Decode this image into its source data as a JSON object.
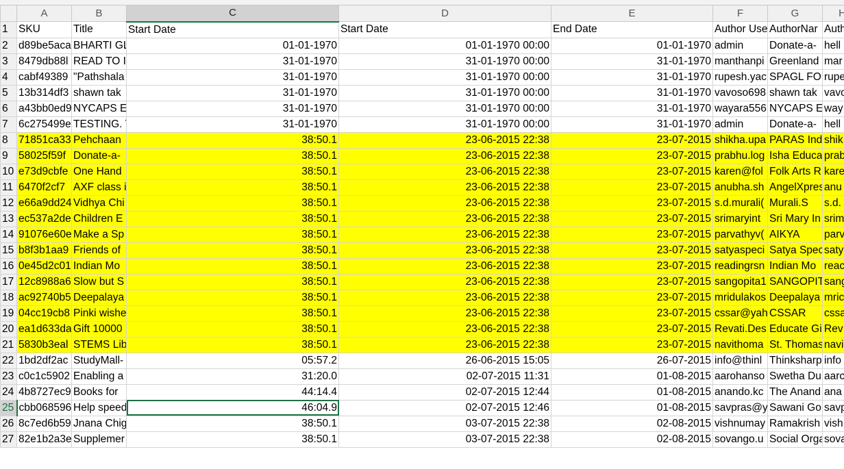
{
  "columns": [
    "A",
    "B",
    "C",
    "D",
    "E",
    "F",
    "G",
    "H"
  ],
  "active_column": "C",
  "active_row": "25",
  "rows": [
    {
      "n": "1",
      "hl": false,
      "cells": [
        "SKU",
        "Title",
        "Start Date",
        "Start Date",
        "End Date",
        "Author Use",
        "AuthorNar",
        "Auth"
      ]
    },
    {
      "n": "2",
      "hl": false,
      "cells": [
        "d89be5aca",
        "BHARTI GL",
        "01-01-1970",
        "01-01-1970 00:00",
        "01-01-1970",
        "admin",
        "Donate-a-",
        "hell"
      ]
    },
    {
      "n": "3",
      "hl": false,
      "cells": [
        "8479db88l",
        "READ  TO I",
        "31-01-1970",
        "31-01-1970 00:00",
        "31-01-1970",
        "manthanpi",
        "Greenland",
        "mar"
      ]
    },
    {
      "n": "4",
      "hl": false,
      "cells": [
        "cabf49389",
        "\"Pathshala",
        "31-01-1970",
        "31-01-1970 00:00",
        "31-01-1970",
        "rupesh.yac",
        "SPAGL FOU",
        "rupe"
      ]
    },
    {
      "n": "5",
      "hl": false,
      "cells": [
        "13b314df3",
        "shawn tak",
        "31-01-1970",
        "31-01-1970 00:00",
        "31-01-1970",
        "vavoso698",
        "shawn tak",
        "vavo"
      ]
    },
    {
      "n": "6",
      "hl": false,
      "cells": [
        "a43bb0ed9",
        "NYCAPS ES",
        "31-01-1970",
        "31-01-1970 00:00",
        "31-01-1970",
        "wayara556",
        "NYCAPS ES",
        "way"
      ]
    },
    {
      "n": "7",
      "hl": false,
      "cells": [
        "6c275499e",
        "TESTING. T",
        "31-01-1970",
        "31-01-1970 00:00",
        "31-01-1970",
        "admin",
        "Donate-a-",
        "hell"
      ]
    },
    {
      "n": "8",
      "hl": true,
      "cells": [
        "71851ca33",
        "Pehchaan",
        "38:50.1",
        "23-06-2015 22:38",
        "23-07-2015",
        "shikha.upa",
        "PARAS Indi",
        "shik"
      ]
    },
    {
      "n": "9",
      "hl": true,
      "cells": [
        "58025f59f",
        "Donate-a-",
        "38:50.1",
        "23-06-2015 22:38",
        "23-07-2015",
        "prabhu.log",
        "Isha Educa",
        "prab"
      ]
    },
    {
      "n": "10",
      "hl": true,
      "cells": [
        "e73d9cbfe",
        "One Hand",
        "38:50.1",
        "23-06-2015 22:38",
        "23-07-2015",
        "karen@fol",
        "Folk Arts R",
        "kare"
      ]
    },
    {
      "n": "11",
      "hl": true,
      "cells": [
        "6470f2cf7",
        "AXF class i",
        "38:50.1",
        "23-06-2015 22:38",
        "23-07-2015",
        "anubha.sh",
        "AngelXpres",
        "anu"
      ]
    },
    {
      "n": "12",
      "hl": true,
      "cells": [
        "e66a9dd24",
        "Vidhya Chi",
        "38:50.1",
        "23-06-2015 22:38",
        "23-07-2015",
        "s.d.murali(",
        "Murali.S",
        "s.d."
      ]
    },
    {
      "n": "13",
      "hl": true,
      "cells": [
        "ec537a2de",
        "Children E",
        "38:50.1",
        "23-06-2015 22:38",
        "23-07-2015",
        "srimaryint",
        "Sri Mary In",
        "srim"
      ]
    },
    {
      "n": "14",
      "hl": true,
      "cells": [
        "91076e60e",
        "Make a Sp",
        "38:50.1",
        "23-06-2015 22:38",
        "23-07-2015",
        "parvathyv(",
        "AIKYA",
        "parv"
      ]
    },
    {
      "n": "15",
      "hl": true,
      "cells": [
        "b8f3b1aa9",
        "Friends of",
        "38:50.1",
        "23-06-2015 22:38",
        "23-07-2015",
        "satyaspeci",
        "Satya Spec",
        "saty"
      ]
    },
    {
      "n": "16",
      "hl": true,
      "cells": [
        "0e45d2c01",
        "Indian Mo",
        "38:50.1",
        "23-06-2015 22:38",
        "23-07-2015",
        "readingrsn",
        "Indian Mo",
        "reac"
      ]
    },
    {
      "n": "17",
      "hl": true,
      "cells": [
        "12c8988a6",
        "Slow but S",
        "38:50.1",
        "23-06-2015 22:38",
        "23-07-2015",
        "sangopita1",
        "SANGOPIT",
        "sang"
      ]
    },
    {
      "n": "18",
      "hl": true,
      "cells": [
        "ac92740b5",
        "Deepalaya",
        "38:50.1",
        "23-06-2015 22:38",
        "23-07-2015",
        "mridulakos",
        "Deepalaya",
        "mric"
      ]
    },
    {
      "n": "19",
      "hl": true,
      "cells": [
        "04cc19cb8",
        "Pinki wishe",
        "38:50.1",
        "23-06-2015 22:38",
        "23-07-2015",
        "cssar@yah",
        "CSSAR",
        "cssa"
      ]
    },
    {
      "n": "20",
      "hl": true,
      "cells": [
        "ea1d633da",
        "Gift 10000",
        "38:50.1",
        "23-06-2015 22:38",
        "23-07-2015",
        "Revati.Des",
        "Educate Gi",
        "Rev"
      ]
    },
    {
      "n": "21",
      "hl": true,
      "cells": [
        "5830b3eal",
        "STEMS Libr",
        "38:50.1",
        "23-06-2015 22:38",
        "23-07-2015",
        "navithoma",
        "St. Thomas",
        "navi"
      ]
    },
    {
      "n": "22",
      "hl": false,
      "cells": [
        "1bd2df2ac",
        "StudyMall-",
        "05:57.2",
        "26-06-2015 15:05",
        "26-07-2015",
        "info@thinl",
        "Thinksharp",
        "info"
      ]
    },
    {
      "n": "23",
      "hl": false,
      "cells": [
        "c0c1c5902",
        "Enabling a",
        "31:20.0",
        "02-07-2015 11:31",
        "01-08-2015",
        "aarohanso",
        "Swetha Du",
        "aarc"
      ]
    },
    {
      "n": "24",
      "hl": false,
      "cells": [
        "4b8727ec9",
        "Books for",
        "44:14.4",
        "02-07-2015 12:44",
        "01-08-2015",
        "anando.kc",
        "The Anand",
        "ana"
      ]
    },
    {
      "n": "25",
      "hl": false,
      "cells": [
        "cbb068596",
        "Help speed",
        "46:04.9",
        "02-07-2015 12:46",
        "01-08-2015",
        "savpras@y",
        "Sawani Go",
        "savp"
      ]
    },
    {
      "n": "26",
      "hl": false,
      "cells": [
        "8c7ed6b59",
        "Jnana Chig",
        "38:50.1",
        "03-07-2015 22:38",
        "02-08-2015",
        "vishnumay",
        "Ramakrish",
        "vish"
      ]
    },
    {
      "n": "27",
      "hl": false,
      "cells": [
        "82e1b2a3e",
        "Supplemer",
        "38:50.1",
        "03-07-2015 22:38",
        "02-08-2015",
        "sovango.u",
        "Social Orga",
        "sova"
      ]
    }
  ]
}
